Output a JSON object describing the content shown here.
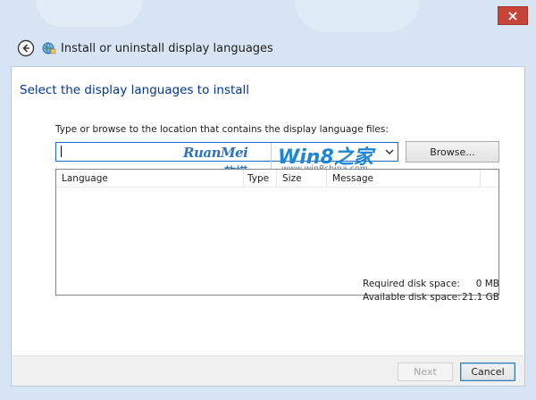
{
  "window": {
    "title": "Install or uninstall display languages",
    "close_icon": "close-icon",
    "back_icon": "back-arrow-icon",
    "app_icon": "globe-language-icon"
  },
  "page": {
    "heading": "Select the display languages to install",
    "path_label": "Type or browse to the location that contains the display language files:",
    "path_value": "",
    "browse_label": "Browse..."
  },
  "watermark": {
    "brand_left": "RuanMei",
    "brand_left_cn": "软媒",
    "brand_right": "Win8之家",
    "url": "www.win8china.com"
  },
  "grid": {
    "columns": [
      "Language",
      "Type",
      "Size",
      "Message"
    ],
    "rows": []
  },
  "disk": {
    "required_label": "Required disk space:",
    "required_value": "0 MB",
    "available_label": "Available disk space:",
    "available_value": "21.1 GB"
  },
  "footer": {
    "next_label": "Next",
    "cancel_label": "Cancel"
  },
  "colors": {
    "heading": "#003399",
    "close": "#c7443a",
    "combo_border": "#1e6ac8"
  }
}
